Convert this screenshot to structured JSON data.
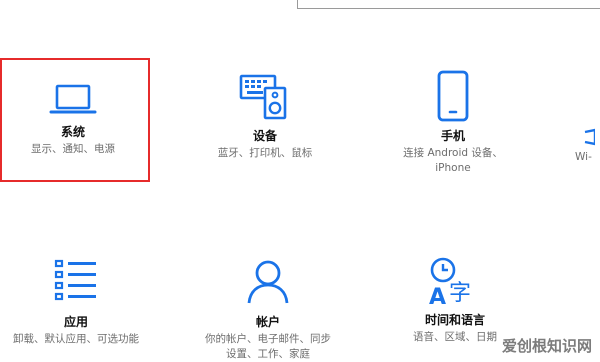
{
  "search": {
    "placeholder": ""
  },
  "tiles": [
    {
      "title": "系统",
      "desc": "显示、通知、电源",
      "icon": "laptop-icon",
      "selected": true
    },
    {
      "title": "设备",
      "desc": "蓝牙、打印机、鼠标",
      "icon": "devices-icon"
    },
    {
      "title": "手机",
      "desc": "连接 Android 设备、\niPhone",
      "icon": "phone-icon"
    },
    {
      "title": "",
      "desc": "Wi-",
      "icon": "network-icon"
    },
    {
      "title": "应用",
      "desc": "卸载、默认应用、可选功能",
      "icon": "apps-icon"
    },
    {
      "title": "帐户",
      "desc": "你的帐户、电子邮件、同步\n设置、工作、家庭",
      "icon": "person-icon"
    },
    {
      "title": "时间和语言",
      "desc": "语音、区域、日期",
      "icon": "time-language-icon"
    }
  ],
  "watermark": "爱创根知识网",
  "accent_color": "#1a73e8"
}
